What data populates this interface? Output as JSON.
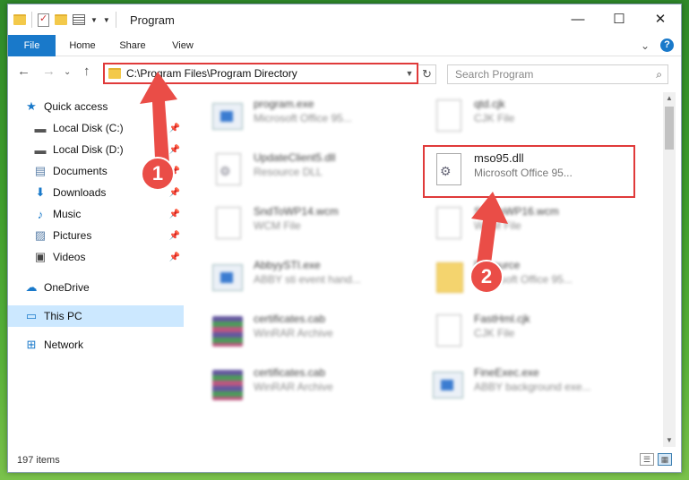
{
  "window": {
    "title": "Program",
    "minimize": "—",
    "maximize": "☐",
    "close": "✕"
  },
  "ribbon": {
    "tabs": [
      "File",
      "Home",
      "Share",
      "View"
    ],
    "collapse_chevron": "⌄",
    "help": "?"
  },
  "nav": {
    "back": "←",
    "forward": "→",
    "recent": "⌄",
    "up": "↑",
    "address": "C:\\Program Files\\Program Directory",
    "refresh": "↻",
    "search_placeholder": "Search Program"
  },
  "sidebar": {
    "items": [
      {
        "label": "Quick access",
        "icon": "star-icon",
        "pinned": false
      },
      {
        "label": "Local Disk (C:)",
        "icon": "drive-icon",
        "pinned": true
      },
      {
        "label": "Local Disk (D:)",
        "icon": "drive-icon",
        "pinned": true
      },
      {
        "label": "Documents",
        "icon": "documents-icon",
        "pinned": true
      },
      {
        "label": "Downloads",
        "icon": "download-icon",
        "pinned": true
      },
      {
        "label": "Music",
        "icon": "music-icon",
        "pinned": true
      },
      {
        "label": "Pictures",
        "icon": "pictures-icon",
        "pinned": true
      },
      {
        "label": "Videos",
        "icon": "videos-icon",
        "pinned": true
      },
      {
        "label": "OneDrive",
        "icon": "cloud-icon",
        "pinned": false
      },
      {
        "label": "This PC",
        "icon": "computer-icon",
        "pinned": false
      },
      {
        "label": "Network",
        "icon": "network-icon",
        "pinned": false
      }
    ]
  },
  "files": [
    {
      "name": "program.exe",
      "type": "Microsoft Office 95...",
      "icon": "exe-icon"
    },
    {
      "name": "qtd.cjk",
      "type": "CJK File",
      "icon": "document-icon"
    },
    {
      "name": "UpdateClient5.dll",
      "type": "Resource DLL",
      "icon": "dll-icon"
    },
    {
      "name": "mso95.dll",
      "type": "Microsoft Office 95...",
      "icon": "dll-icon"
    },
    {
      "name": "SndToWP14.wcm",
      "type": "WCM File",
      "icon": "document-icon"
    },
    {
      "name": "SndToWP16.wcm",
      "type": "WCM File",
      "icon": "document-icon"
    },
    {
      "name": "AbbyySTI.exe",
      "type": "ABBY sti event hand...",
      "icon": "exe-icon"
    },
    {
      "name": "Resource",
      "type": "Microsoft Office 95...",
      "icon": "folder-icon"
    },
    {
      "name": "certificates.cab",
      "type": "WinRAR Archive",
      "icon": "archive-icon"
    },
    {
      "name": "FastHml.cjk",
      "type": "CJK File",
      "icon": "document-icon"
    },
    {
      "name": "certificates.cab",
      "type": "WinRAR Archive",
      "icon": "archive-icon"
    },
    {
      "name": "FineExec.exe",
      "type": "ABBY background exe...",
      "icon": "exe-icon"
    }
  ],
  "status": {
    "item_count": "197 items"
  },
  "annotations": {
    "step1": "1",
    "step2": "2",
    "color": "#ea4d47"
  }
}
